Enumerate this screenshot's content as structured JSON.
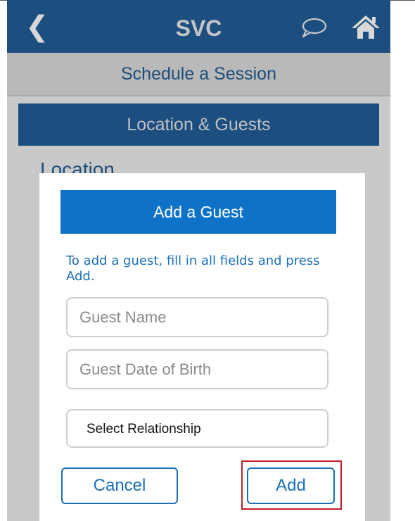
{
  "navbar": {
    "back_icon": "chevron-left-icon",
    "title": "SVC",
    "chat_icon": "speech-bubble-icon",
    "home_icon": "home-icon"
  },
  "subheader": {
    "title": "Schedule a Session"
  },
  "section": {
    "title": "Location & Guests",
    "location_label": "Location"
  },
  "modal": {
    "title": "Add a Guest",
    "instructions": "To add a guest, fill in all fields and press Add.",
    "guest_name": {
      "placeholder": "Guest Name",
      "value": ""
    },
    "guest_dob": {
      "placeholder": "Guest Date of Birth",
      "value": ""
    },
    "relationship": {
      "selected": "Select Relationship"
    },
    "cancel_label": "Cancel",
    "add_label": "Add"
  },
  "colors": {
    "navbar": "#1c4e80",
    "modal_header": "#0e73c7",
    "accent_text": "#1a6fb8",
    "highlight": "#c0202a"
  }
}
